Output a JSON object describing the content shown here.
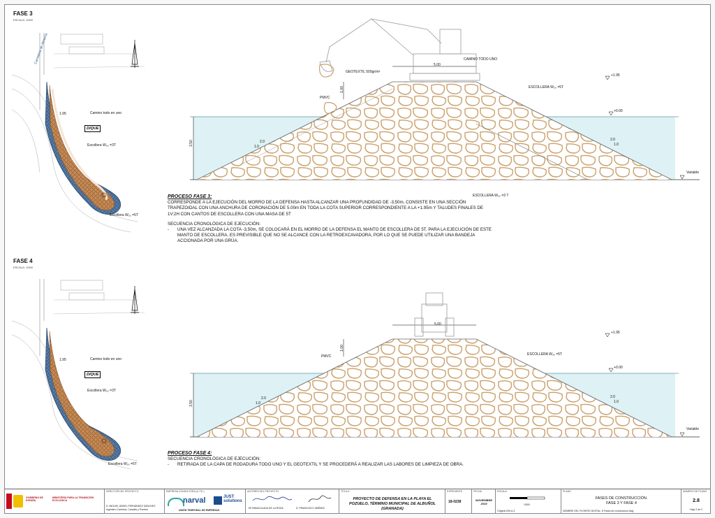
{
  "fase3": {
    "title": "FASE 3",
    "scale": "ESCALA: 1/500",
    "plan_labels": {
      "road_label": "Camino todo en uno",
      "dique": "DIQUE",
      "escollera_3t": "Escollera W₅₀ =3T",
      "escollera_5t": "Escollera W₅₀ =5T",
      "street": "Carretera de Almería",
      "point": "1.95"
    },
    "section_labels": {
      "camino": "CAMINO TODO UNO",
      "geotextil": "GEOTEXTIL 500gr/m²",
      "width": "5.00",
      "level_top": "+1.95",
      "level_zero": "+0.00",
      "pmvc": "PMVC",
      "height_top": "1.00",
      "height_depth": "3.50",
      "escollera_5t": "ESCOLLERA W₅₀ =5T",
      "escollera_3t": "ESCOLLERA W₅₀ =3 T",
      "slope_v": "1.0",
      "slope_h": "2.0",
      "variable": "Variable"
    },
    "process_title": "PROCESO FASE 3:",
    "description": "CORRESPONDE A LA EJECUCIÓN DEL MORRO DE LA DEFENSA HASTA ALCANZAR UNA PROFUNDIDAD DE -3,50m, CONSISTE EN UNA SECCIÓN TRAPEZOIDAL CON UNA ANCHURA DE CORONACIÓN DE 5.00m EN TODA LA COTA SUPERIOR CORRESPONDIENTE A LA +1.95m Y TALUDES FINALES DE 1V:2H CON CANTOS DE ESCOLLERA CON UNA MASA DE 5T",
    "sequence_title": "SECUENCIA CRONOLÓGICA DE EJECUCIÓN:",
    "sequence_items": [
      "UNA VEZ ALCANZADA LA COTA -3,50m, SE COLOCARÁ EN EL MORRO DE LA DEFENSA EL MANTO DE ESCOLLERA DE 5T. PARA LA EJECUCIÓN DE ESTE MANTO DE ESCOLLERA, ES PREVISIBLE QUE NO SE ALCANCE CON LA RETROEXCAVADORA, POR LO QUE SE PUEDE UTILIZAR UNA BANDEJA ACCIONADA POR UNA GRÚA."
    ]
  },
  "fase4": {
    "title": "FASE 4",
    "scale": "ESCALA: 1/500",
    "plan_labels": {
      "road_label": "Camino todo en uno",
      "dique": "DIQUE",
      "escollera_3t": "Escollera W₅₀ =3T",
      "escollera_5t": "Escollera W₅₀ =5T",
      "point": "1.95"
    },
    "section_labels": {
      "width": "5.00",
      "level_top": "+1.95",
      "level_zero": "+0.00",
      "pmvc": "PMVC",
      "height_top": "1.00",
      "height_depth": "3.50",
      "escollera_5t": "ESCOLLERA W₅₀ =5T",
      "slope_v": "1.0",
      "slope_h": "2.0",
      "variable": "Variable"
    },
    "process_title": "PROCESO FASE 4:",
    "sequence_title": "SECUENCIA CRONOLÓGICA DE EJECUCIÓN:",
    "sequence_items": [
      "RETIRADA DE LA CAPA DE RODADURA TODO UNO Y EL GEOTEXTIL Y SE PROCEDERÁ A REALIZAR LAS LABORES DE LIMPIEZA DE OBRA."
    ]
  },
  "title_block": {
    "gov_line1": "GOBIERNO DE ESPAÑA",
    "gov_line2": "MINISTERIO PARA LA TRANSICIÓN ECOLÓGICA",
    "director_head": "DIRECTOR DEL PROYECTO",
    "director_name": "D. MIGUEL ÁNGEL FERNÁNDEZ SÁNCHEZ",
    "director_role": "Ingeniero Caminos, Canales y Puertos",
    "company_head": "EMPRESA CONSULTORA (U.T.E.)",
    "company_narval": "narval",
    "company_just": "JUST solutions",
    "company_ute": "UNIÓN TEMPORAL DE EMPRESAS",
    "authors_head": "AUTORES DEL PROYECTO",
    "author1": "Mª INMACULADA DE LA ROSA",
    "author2": "D. FRANCISCO JIMÉNEZ",
    "project_head": "TÍTULO",
    "project_title": "PROYECTO DE DEFENSA EN LA PLAYA EL POZUELO, TÉRMINO MUNICIPAL DE ALBUÑOL (GRANADA)",
    "exp_head": "EXPEDIENTE",
    "exp_value": "18-0238",
    "date_head": "FECHA",
    "date_value": "NOVIEMBRE 2019",
    "scale_head": "ESCALA",
    "scale_value": "1/500",
    "scale_orig": "Original DIN A-3",
    "plano_head": "PLANO",
    "plano_title1": "FASES DE CONSTRUCCIÓN.",
    "plano_title2": "FASE 3 Y FASE 4",
    "file_name": "NOMBRE DEL FICHERO DIGITAL: 8 Fases de construccion.dwg",
    "num_head": "NÚMERO DE PLANO",
    "num_value": "2.8",
    "sheet_value": "Hoja 2 de 2"
  },
  "colors": {
    "water": "#def1f4",
    "rock_stroke": "#c9a06b",
    "rock_fill_plan": "#c88b55",
    "plan_outline": "#3d6e9e"
  }
}
